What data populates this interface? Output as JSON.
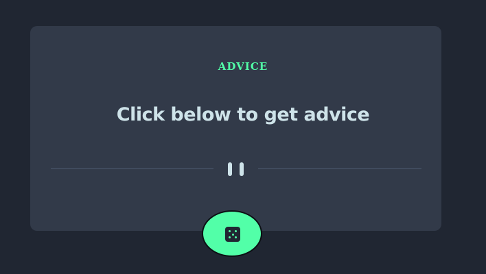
{
  "card": {
    "eyebrow": "ADVICE",
    "headline": "Click below to get advice"
  },
  "dice_button": {
    "icon": "dice-icon"
  },
  "colors": {
    "background": "#202632",
    "card": "#323a49",
    "accent": "#52ffa8",
    "text": "#cee3e9",
    "divider": "#4f5d74"
  }
}
